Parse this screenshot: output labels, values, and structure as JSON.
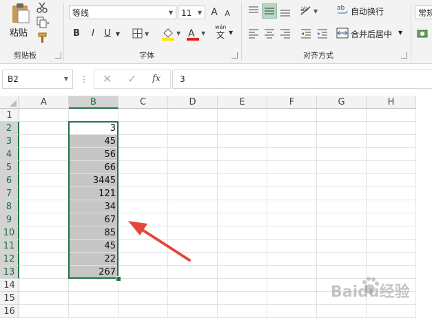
{
  "clipboard": {
    "paste_label": "粘贴",
    "group_label": "剪贴板"
  },
  "font": {
    "family": "等线",
    "size": "11",
    "bold": "B",
    "italic": "I",
    "underline": "U",
    "grow": "A",
    "shrink": "A",
    "wen": "wén",
    "group_label": "字体",
    "highlight_color": "#ffe600",
    "font_color": "#e02020"
  },
  "align": {
    "wrap_label": "自动换行",
    "merge_label": "合并后居中",
    "group_label": "对齐方式"
  },
  "number": {
    "format": "常规"
  },
  "formula_bar": {
    "name_box": "B2",
    "fx": "fx",
    "value": "3"
  },
  "columns": [
    "A",
    "B",
    "C",
    "D",
    "E",
    "F",
    "G",
    "H"
  ],
  "rows": [
    "1",
    "2",
    "3",
    "4",
    "5",
    "6",
    "7",
    "8",
    "9",
    "10",
    "11",
    "12",
    "13",
    "14",
    "15",
    "16"
  ],
  "column_b_values": [
    "",
    "3",
    "45",
    "56",
    "66",
    "3445",
    "121",
    "34",
    "67",
    "85",
    "45",
    "22",
    "267",
    "",
    "",
    ""
  ],
  "watermark": "Baidu经验",
  "accent_color": "#217346",
  "arrow_color": "#e4463b"
}
